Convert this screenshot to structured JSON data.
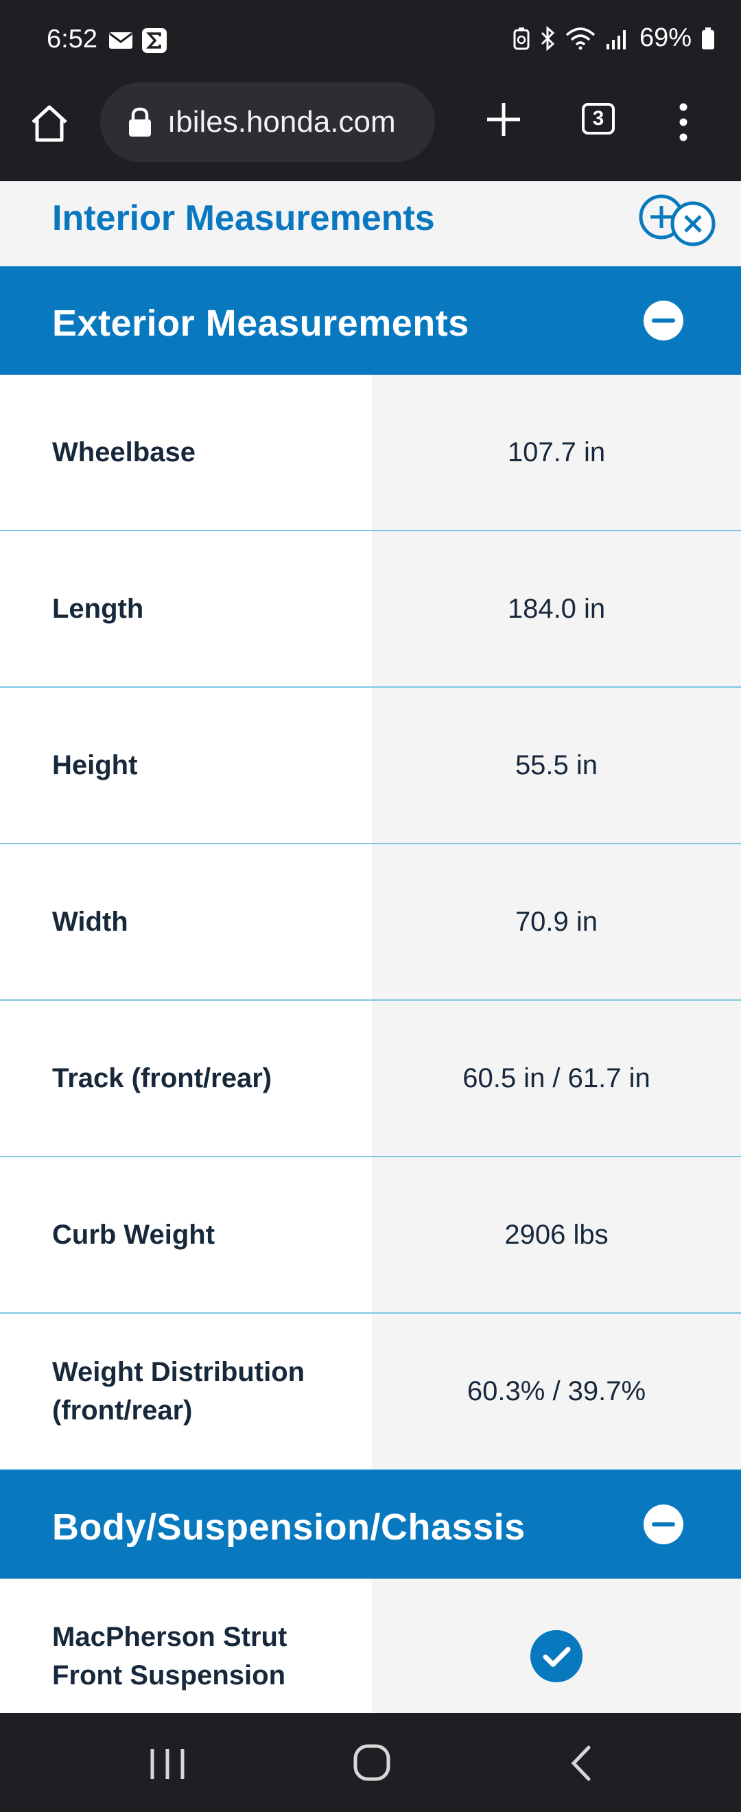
{
  "status_bar": {
    "time": "6:52",
    "battery": "69%"
  },
  "browser": {
    "url": "ıbiles.honda.com",
    "tab_count": "3"
  },
  "interior_section": {
    "title": "Interior Measurements"
  },
  "exterior_section": {
    "title": "Exterior Measurements",
    "rows": [
      {
        "label": "Wheelbase",
        "value": "107.7 in"
      },
      {
        "label": "Length",
        "value": "184.0 in"
      },
      {
        "label": "Height",
        "value": "55.5 in"
      },
      {
        "label": "Width",
        "value": "70.9 in"
      },
      {
        "label": "Track (front/rear)",
        "value": "60.5 in / 61.7 in"
      },
      {
        "label": "Curb Weight",
        "value": "2906 lbs"
      },
      {
        "label": "Weight Distribution (front/rear)",
        "value": "60.3% / 39.7%"
      }
    ]
  },
  "body_section": {
    "title": "Body/Suspension/Chassis",
    "rows": [
      {
        "label": "MacPherson Strut Front Suspension",
        "value_icon": "check-circle-icon"
      }
    ]
  },
  "colors": {
    "accent": "#0979bf",
    "row_divider": "#7ec6e6",
    "text_dark": "#17283b"
  }
}
